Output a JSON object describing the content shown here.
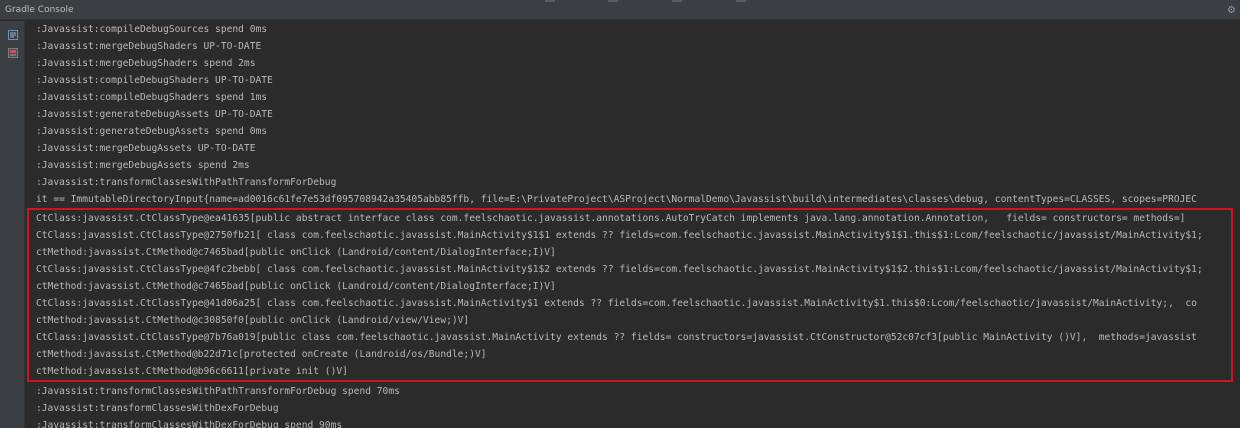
{
  "window": {
    "title": "Gradle Console"
  },
  "toolbar": {
    "settings_glyph": "⚙"
  },
  "console": {
    "lines": [
      ":Javassist:compileDebugSources spend 0ms",
      ":Javassist:mergeDebugShaders UP-TO-DATE",
      ":Javassist:mergeDebugShaders spend 2ms",
      ":Javassist:compileDebugShaders UP-TO-DATE",
      ":Javassist:compileDebugShaders spend 1ms",
      ":Javassist:generateDebugAssets UP-TO-DATE",
      ":Javassist:generateDebugAssets spend 0ms",
      ":Javassist:mergeDebugAssets UP-TO-DATE",
      ":Javassist:mergeDebugAssets spend 2ms",
      ":Javassist:transformClassesWithPathTransformForDebug",
      "it == ImmutableDirectoryInput{name=ad0016c61fe7e53df095708942a35405abb85ffb, file=E:\\PrivateProject\\ASProject\\NormalDemo\\Javassist\\build\\intermediates\\classes\\debug, contentTypes=CLASSES, scopes=PROJEC",
      "CtClass:javassist.CtClassType@ea41635[public abstract interface class com.feelschaotic.javassist.annotations.AutoTryCatch implements java.lang.annotation.Annotation,   fields= constructors= methods=]",
      "CtClass:javassist.CtClassType@2750fb21[ class com.feelschaotic.javassist.MainActivity$1$1 extends ?? fields=com.feelschaotic.javassist.MainActivity$1$1.this$1:Lcom/feelschaotic/javassist/MainActivity$1;",
      "ctMethod:javassist.CtMethod@c7465bad[public onClick (Landroid/content/DialogInterface;I)V]",
      "CtClass:javassist.CtClassType@4fc2bebb[ class com.feelschaotic.javassist.MainActivity$1$2 extends ?? fields=com.feelschaotic.javassist.MainActivity$1$2.this$1:Lcom/feelschaotic/javassist/MainActivity$1;",
      "ctMethod:javassist.CtMethod@c7465bad[public onClick (Landroid/content/DialogInterface;I)V]",
      "CtClass:javassist.CtClassType@41d06a25[ class com.feelschaotic.javassist.MainActivity$1 extends ?? fields=com.feelschaotic.javassist.MainActivity$1.this$0:Lcom/feelschaotic/javassist/MainActivity;,  co",
      "ctMethod:javassist.CtMethod@c30850f0[public onClick (Landroid/view/View;)V]",
      "CtClass:javassist.CtClassType@7b76a019[public class com.feelschaotic.javassist.MainActivity extends ?? fields= constructors=javassist.CtConstructor@52c07cf3[public MainActivity ()V],  methods=javassist",
      "ctMethod:javassist.CtMethod@b22d71c[protected onCreate (Landroid/os/Bundle;)V]",
      "ctMethod:javassist.CtMethod@b96c6611[private init ()V]",
      ":Javassist:transformClassesWithPathTransformForDebug spend 70ms",
      ":Javassist:transformClassesWithDexForDebug",
      ":Javassist:transformClassesWithDexForDebug spend 90ms"
    ]
  }
}
